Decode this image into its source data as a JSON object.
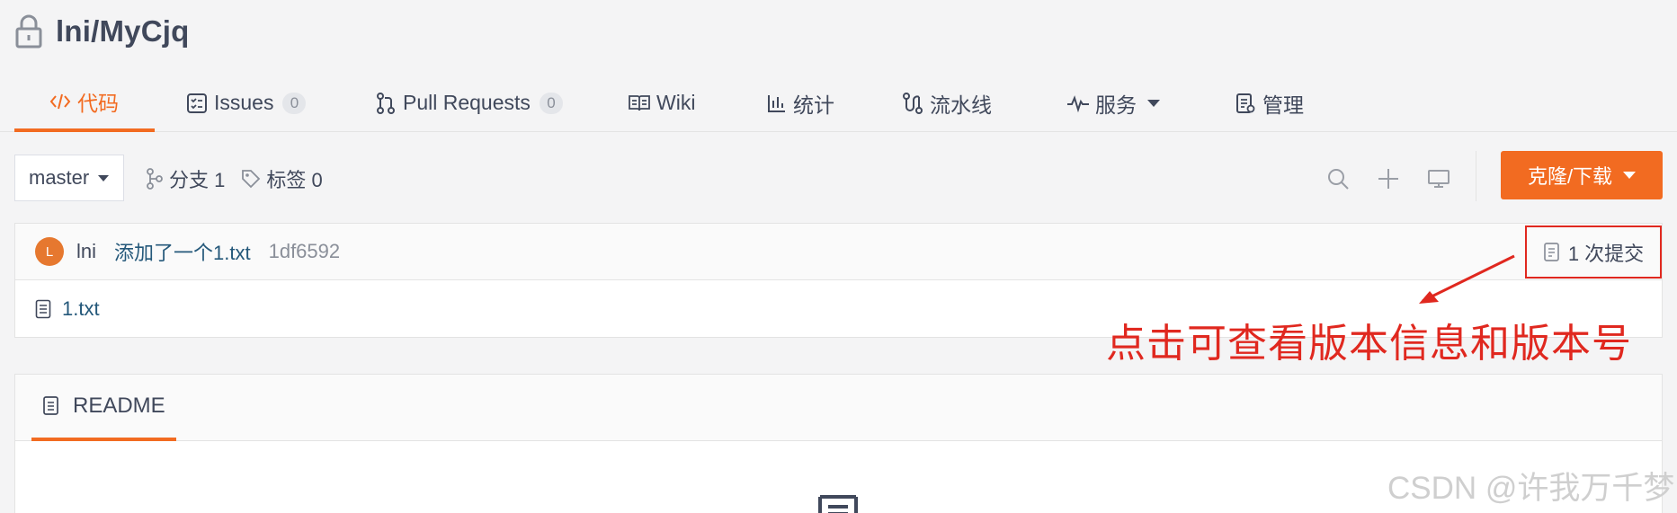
{
  "repo": {
    "name": "lni/MyCjq"
  },
  "nav": {
    "tabs": [
      {
        "label": "代码",
        "icon": "code-icon"
      },
      {
        "label": "Issues",
        "badge": "0",
        "icon": "issues-icon"
      },
      {
        "label": "Pull Requests",
        "badge": "0",
        "icon": "pull-request-icon"
      },
      {
        "label": "Wiki",
        "icon": "wiki-icon"
      },
      {
        "label": "统计",
        "icon": "stats-icon"
      },
      {
        "label": "流水线",
        "icon": "pipeline-icon"
      },
      {
        "label": "服务",
        "icon": "service-icon"
      },
      {
        "label": "管理",
        "icon": "manage-icon"
      }
    ]
  },
  "toolbar": {
    "branch": "master",
    "branches_label": "分支 1",
    "tags_label": "标签 0",
    "clone_label": "克隆/下载"
  },
  "commit": {
    "avatar_initial": "L",
    "author": "lni",
    "message": "添加了一个1.txt",
    "sha": "1df6592",
    "count_label": "1 次提交"
  },
  "files": [
    {
      "name": "1.txt"
    }
  ],
  "annotation": {
    "text": "点击可查看版本信息和版本号"
  },
  "readme": {
    "tab_label": "README"
  },
  "watermark": "CSDN @许我万千梦",
  "colors": {
    "accent": "#f26b21",
    "annotation": "#e0281f",
    "link": "#24587a"
  }
}
